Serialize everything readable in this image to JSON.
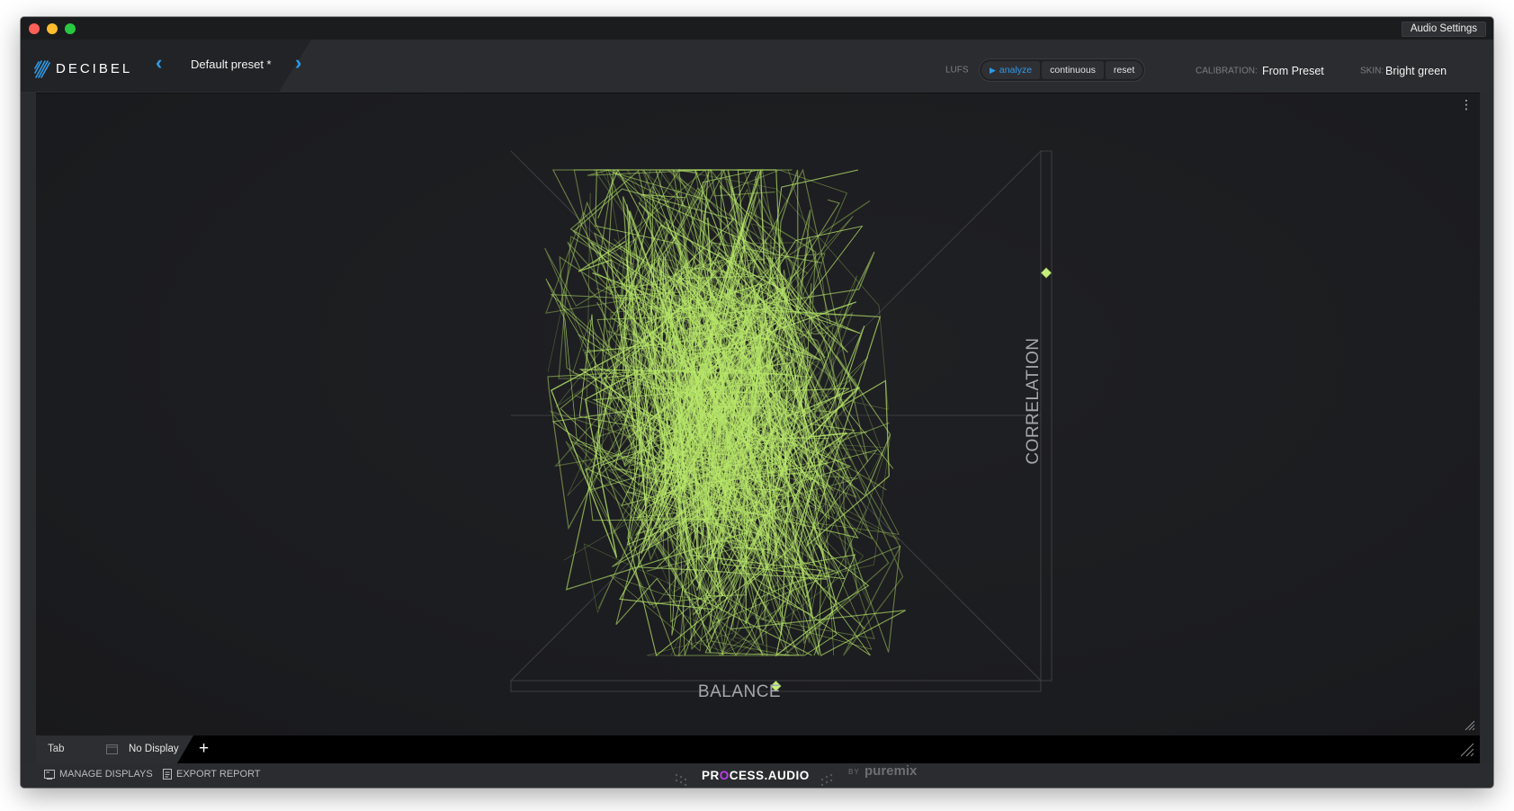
{
  "window": {
    "audio_settings_label": "Audio Settings"
  },
  "header": {
    "logo_text": "DECIBEL",
    "preset_name": "Default preset *",
    "prev_icon": "chevron-left-icon",
    "next_icon": "chevron-right-icon",
    "lufs_label": "LUFS",
    "lufs_buttons": {
      "analyze": "analyze",
      "continuous": "continuous",
      "reset": "reset"
    },
    "calibration_label": "CALIBRATION:",
    "calibration_value": "From Preset",
    "skin_label": "SKIN:",
    "skin_value": "Bright green"
  },
  "display": {
    "type": "stereo-scope",
    "balance_label": "BALANCE",
    "correlation_label": "CORRELATION",
    "menu_icon": "more-vertical-icon",
    "balance_marker": 0.0,
    "correlation_marker": 0.54,
    "trace_color": "#b9e86a"
  },
  "tabbar": {
    "tab_label": "Tab",
    "display_name": "No Display",
    "add_label": "+"
  },
  "footer": {
    "manage_displays": "MANAGE DISPLAYS",
    "export_report": "EXPORT REPORT",
    "brand_pr": "PR",
    "brand_o": "O",
    "brand_rest": "CESS.AUDIO",
    "by_label": "BY",
    "puremix": "puremix"
  },
  "colors": {
    "accent": "#2f9ae6",
    "trace": "#b9e86a",
    "background": "#1c1d20"
  }
}
